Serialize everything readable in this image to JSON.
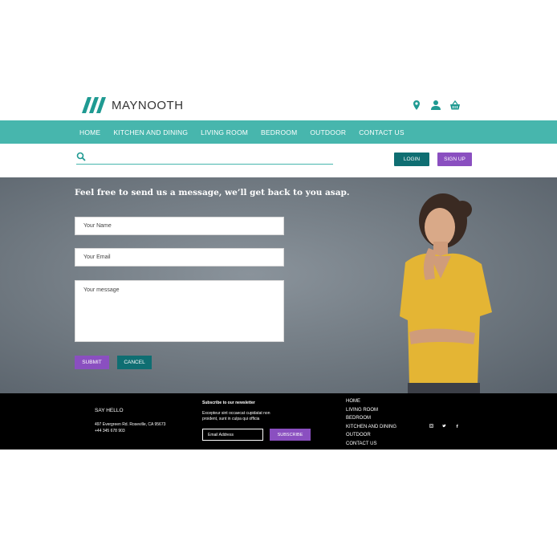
{
  "brand": {
    "name": "MAYNOOTH"
  },
  "header_icons": [
    "location-pin-icon",
    "user-icon",
    "shopping-basket-icon"
  ],
  "nav": {
    "items": [
      {
        "label": "HOME"
      },
      {
        "label": "KITCHEN AND DINING"
      },
      {
        "label": "LIVING ROOM"
      },
      {
        "label": "BEDROOM"
      },
      {
        "label": "OUTDOOR"
      },
      {
        "label": "CONTACT US"
      }
    ]
  },
  "search": {
    "placeholder": "",
    "icon": "search-icon"
  },
  "auth": {
    "login": "LOGIN",
    "signup": "SIGN UP"
  },
  "contact": {
    "heading": "Feel free to send us a message, we’ll get back to you asap.",
    "name_placeholder": "Your Name",
    "email_placeholder": "Your Email",
    "message_placeholder": "Your message",
    "submit": "SUBMIT",
    "cancel": "CANCEL"
  },
  "footer": {
    "say_hello": "SAY HELLO",
    "address": "497 Evergreen Rd. Roseville, CA 95673",
    "phone": "+44 345 678 903",
    "newsletter_title": "Subscribe to our newsletter",
    "newsletter_text": "Excepteur sint occaecat cupidatat non proident, sunt in culpa qui officia",
    "email_placeholder": "Email Address",
    "subscribe": "SUBSCRIBE",
    "links": [
      {
        "label": "HOME"
      },
      {
        "label": "LIVING ROOM"
      },
      {
        "label": "BEDROOM"
      },
      {
        "label": "KITCHEN AND DINING"
      },
      {
        "label": "OUTDOOR"
      },
      {
        "label": "CONTACT US"
      }
    ],
    "social": [
      "instagram-icon",
      "twitter-icon",
      "facebook-icon"
    ]
  },
  "colors": {
    "teal": "#47b6ad",
    "dark_teal": "#0f6e72",
    "purple": "#8a4fc0",
    "footer_bg": "#000000"
  }
}
